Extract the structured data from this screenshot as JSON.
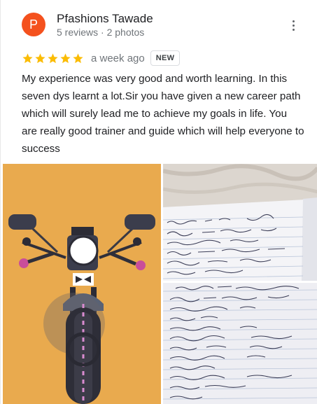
{
  "reviewer": {
    "initial": "P",
    "name": "Pfashions Tawade",
    "meta": "5 reviews · 2 photos",
    "avatar_color": "#f4511e"
  },
  "rating": {
    "stars": 5,
    "star_color": "#fbbc04",
    "time": "a week ago",
    "badge": "NEW"
  },
  "review_text": "My experience was very good and worth learning. In this seven dys learnt a lot.Sir you have given a new career path which will surely lead me to achieve my goals in life. You are really good trainer and guide which will help everyone to success",
  "photos": [
    {
      "name": "motorcycle-illustration"
    },
    {
      "name": "handwritten-notes-1"
    },
    {
      "name": "handwritten-notes-2"
    }
  ],
  "icons": [
    "star-icon",
    "more-vert-icon"
  ]
}
